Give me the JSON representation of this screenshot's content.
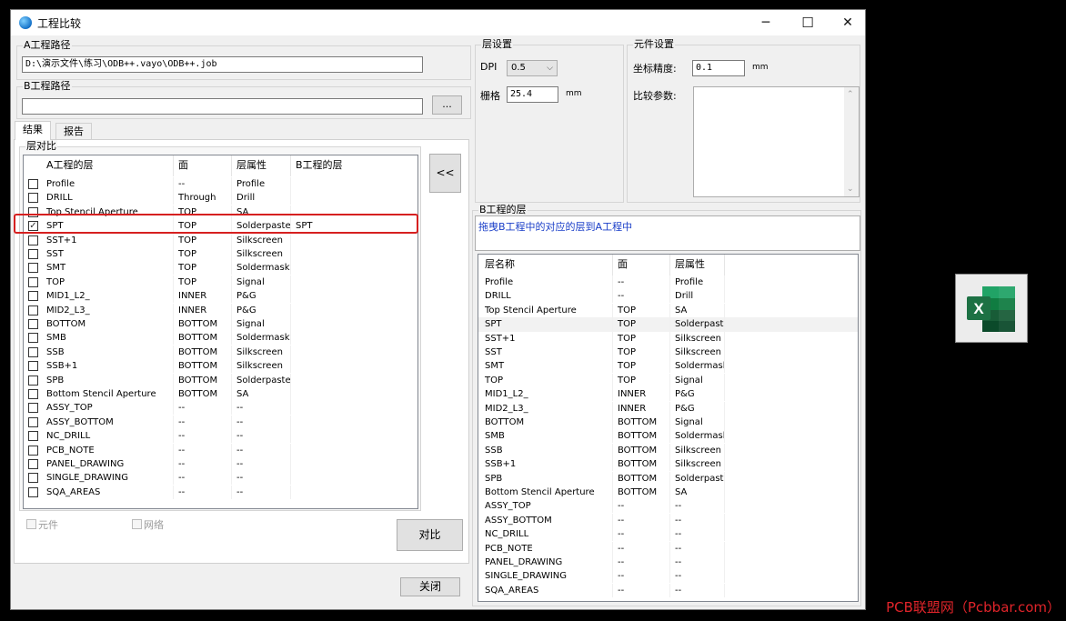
{
  "window": {
    "title": "工程比较",
    "min_glyph": "─",
    "max_glyph": "☐",
    "close_glyph": "✕"
  },
  "path_a": {
    "label": "A工程路径",
    "value": "D:\\演示文件\\练习\\ODB++.vayo\\ODB++.job"
  },
  "path_b": {
    "label": "B工程路径",
    "value": "",
    "browse_label": "..."
  },
  "tabs": [
    {
      "label": "结果"
    },
    {
      "label": "报告"
    }
  ],
  "layer_compare": {
    "label": "层对比",
    "swap_button": "<<",
    "columns": [
      "A工程的层",
      "面",
      "层属性",
      "B工程的层"
    ],
    "rows": [
      {
        "checked": false,
        "layer": "Profile",
        "side": "--",
        "attr": "Profile",
        "b_layer": ""
      },
      {
        "checked": false,
        "layer": "DRILL",
        "side": "Through",
        "attr": "Drill",
        "b_layer": ""
      },
      {
        "checked": false,
        "layer": "Top Stencil Aperture",
        "side": "TOP",
        "attr": "SA",
        "b_layer": ""
      },
      {
        "checked": true,
        "layer": "SPT",
        "side": "TOP",
        "attr": "Solderpaste",
        "b_layer": "SPT"
      },
      {
        "checked": false,
        "layer": "SST+1",
        "side": "TOP",
        "attr": "Silkscreen",
        "b_layer": ""
      },
      {
        "checked": false,
        "layer": "SST",
        "side": "TOP",
        "attr": "Silkscreen",
        "b_layer": ""
      },
      {
        "checked": false,
        "layer": "SMT",
        "side": "TOP",
        "attr": "Soldermask",
        "b_layer": ""
      },
      {
        "checked": false,
        "layer": "TOP",
        "side": "TOP",
        "attr": "Signal",
        "b_layer": ""
      },
      {
        "checked": false,
        "layer": "MID1_L2_",
        "side": "INNER",
        "attr": "P&G",
        "b_layer": ""
      },
      {
        "checked": false,
        "layer": "MID2_L3_",
        "side": "INNER",
        "attr": "P&G",
        "b_layer": ""
      },
      {
        "checked": false,
        "layer": "BOTTOM",
        "side": "BOTTOM",
        "attr": "Signal",
        "b_layer": ""
      },
      {
        "checked": false,
        "layer": "SMB",
        "side": "BOTTOM",
        "attr": "Soldermask",
        "b_layer": ""
      },
      {
        "checked": false,
        "layer": "SSB",
        "side": "BOTTOM",
        "attr": "Silkscreen",
        "b_layer": ""
      },
      {
        "checked": false,
        "layer": "SSB+1",
        "side": "BOTTOM",
        "attr": "Silkscreen",
        "b_layer": ""
      },
      {
        "checked": false,
        "layer": "SPB",
        "side": "BOTTOM",
        "attr": "Solderpaste",
        "b_layer": ""
      },
      {
        "checked": false,
        "layer": "Bottom Stencil Aperture",
        "side": "BOTTOM",
        "attr": "SA",
        "b_layer": ""
      },
      {
        "checked": false,
        "layer": "ASSY_TOP",
        "side": "--",
        "attr": "--",
        "b_layer": ""
      },
      {
        "checked": false,
        "layer": "ASSY_BOTTOM",
        "side": "--",
        "attr": "--",
        "b_layer": ""
      },
      {
        "checked": false,
        "layer": "NC_DRILL",
        "side": "--",
        "attr": "--",
        "b_layer": ""
      },
      {
        "checked": false,
        "layer": "PCB_NOTE",
        "side": "--",
        "attr": "--",
        "b_layer": ""
      },
      {
        "checked": false,
        "layer": "PANEL_DRAWING",
        "side": "--",
        "attr": "--",
        "b_layer": ""
      },
      {
        "checked": false,
        "layer": "SINGLE_DRAWING",
        "side": "--",
        "attr": "--",
        "b_layer": ""
      },
      {
        "checked": false,
        "layer": "SQA_AREAS",
        "side": "--",
        "attr": "--",
        "b_layer": ""
      }
    ]
  },
  "options": {
    "component_label": "元件",
    "net_label": "网络"
  },
  "compare_button": "对比",
  "close_button": "关闭",
  "layer_settings": {
    "label": "层设置",
    "dpi_label": "DPI",
    "dpi_value": "0.5",
    "grid_label": "栅格",
    "grid_value": "25.4",
    "grid_unit": "mm"
  },
  "component_settings": {
    "label": "元件设置",
    "precision_label": "坐标精度:",
    "precision_value": "0.1",
    "precision_unit": "mm",
    "params_label": "比较参数:"
  },
  "b_layers": {
    "label": "B工程的层",
    "hint": "拖曳B工程中的对应的层到A工程中",
    "columns": [
      "层名称",
      "面",
      "层属性"
    ],
    "rows": [
      {
        "layer": "Profile",
        "side": "--",
        "attr": "Profile"
      },
      {
        "layer": "DRILL",
        "side": "--",
        "attr": "Drill"
      },
      {
        "layer": "Top Stencil Aperture",
        "side": "TOP",
        "attr": "SA"
      },
      {
        "layer": "SPT",
        "side": "TOP",
        "attr": "Solderpaste"
      },
      {
        "layer": "SST+1",
        "side": "TOP",
        "attr": "Silkscreen"
      },
      {
        "layer": "SST",
        "side": "TOP",
        "attr": "Silkscreen"
      },
      {
        "layer": "SMT",
        "side": "TOP",
        "attr": "Soldermask"
      },
      {
        "layer": "TOP",
        "side": "TOP",
        "attr": "Signal"
      },
      {
        "layer": "MID1_L2_",
        "side": "INNER",
        "attr": "P&G"
      },
      {
        "layer": "MID2_L3_",
        "side": "INNER",
        "attr": "P&G"
      },
      {
        "layer": "BOTTOM",
        "side": "BOTTOM",
        "attr": "Signal"
      },
      {
        "layer": "SMB",
        "side": "BOTTOM",
        "attr": "Soldermask"
      },
      {
        "layer": "SSB",
        "side": "BOTTOM",
        "attr": "Silkscreen"
      },
      {
        "layer": "SSB+1",
        "side": "BOTTOM",
        "attr": "Silkscreen"
      },
      {
        "layer": "SPB",
        "side": "BOTTOM",
        "attr": "Solderpaste"
      },
      {
        "layer": "Bottom Stencil Aperture",
        "side": "BOTTOM",
        "attr": "SA"
      },
      {
        "layer": "ASSY_TOP",
        "side": "--",
        "attr": "--"
      },
      {
        "layer": "ASSY_BOTTOM",
        "side": "--",
        "attr": "--"
      },
      {
        "layer": "NC_DRILL",
        "side": "--",
        "attr": "--"
      },
      {
        "layer": "PCB_NOTE",
        "side": "--",
        "attr": "--"
      },
      {
        "layer": "PANEL_DRAWING",
        "side": "--",
        "attr": "--"
      },
      {
        "layer": "SINGLE_DRAWING",
        "side": "--",
        "attr": "--"
      },
      {
        "layer": "SQA_AREAS",
        "side": "--",
        "attr": "--"
      }
    ]
  },
  "excel_icon": {
    "letter": "X"
  },
  "watermark": "PCB联盟网（Pcbbar.com）",
  "colors": {
    "highlight_box": "#d62020",
    "hint_text": "#1a3ec8",
    "excel_green": "#1d7144",
    "watermark": "#e0242a"
  }
}
